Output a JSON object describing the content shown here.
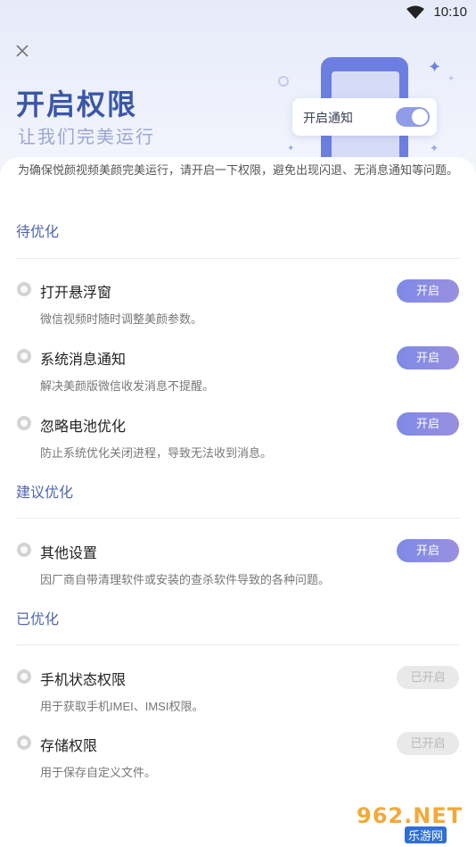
{
  "status_bar": {
    "time": "10:10",
    "wifi_icon": "wifi-icon"
  },
  "header": {
    "close_icon": "close-icon",
    "title": "开启权限",
    "subtitle": "让我们完美运行",
    "illustration": {
      "card_label": "开启通知",
      "toggle_on": true,
      "accent": "#6c7fe0"
    }
  },
  "intro": "为确保悦颜视频美颜完美运行，请开启一下权限，避免出现闪退、无消息通知等问题。",
  "sections": [
    {
      "title": "待优化",
      "items": [
        {
          "title": "打开悬浮窗",
          "desc": "微信视频时随时调整美颜参数。",
          "button": "开启"
        },
        {
          "title": "系统消息通知",
          "desc": "解决美颜版微信收发消息不提醒。",
          "button": "开启"
        },
        {
          "title": "忽略电池优化",
          "desc": "防止系统优化关闭进程，导致无法收到消息。",
          "button": "开启"
        }
      ]
    },
    {
      "title": "建议优化",
      "items": [
        {
          "title": "其他设置",
          "desc": "因厂商自带清理软件或安装的查杀软件导致的各种问题。",
          "button": "开启"
        }
      ]
    },
    {
      "title": "已优化",
      "items": [
        {
          "title": "手机状态权限",
          "desc": "用于获取手机IMEI、IMSI权限。",
          "button": "已开启"
        },
        {
          "title": "存储权限",
          "desc": "用于保存自定义文件。",
          "button": "已开启"
        }
      ]
    }
  ],
  "watermark": {
    "text": "962.NET",
    "sub": "乐游网"
  },
  "colors": {
    "accent": "#4f66b0",
    "button": "#8a8fe4",
    "disabled": "#e9e9e9"
  }
}
